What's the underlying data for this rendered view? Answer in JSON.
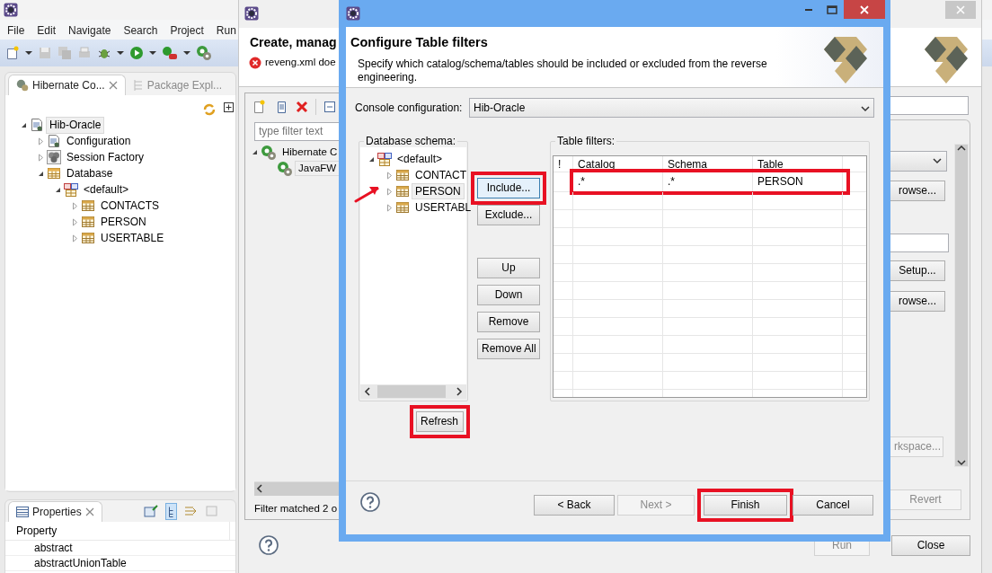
{
  "ide": {
    "menu": [
      "File",
      "Edit",
      "Navigate",
      "Search",
      "Project",
      "Run"
    ],
    "view_tabs": [
      {
        "label": "Hibernate Co...",
        "selected": true
      },
      {
        "label": "Package Expl...",
        "selected": false
      }
    ],
    "tree": [
      {
        "label": "Hib-Oracle",
        "kind": "config",
        "expanded": true,
        "selected": true,
        "children": [
          {
            "label": "Configuration",
            "kind": "config",
            "expanded": false,
            "selected": false
          },
          {
            "label": "Session Factory",
            "kind": "factory",
            "expanded": false,
            "selected": false
          },
          {
            "label": "Database",
            "kind": "database",
            "expanded": true,
            "selected": false,
            "children": [
              {
                "label": "<default>",
                "kind": "schema",
                "expanded": true,
                "selected": false,
                "children": [
                  {
                    "label": "CONTACTS",
                    "kind": "table",
                    "expanded": false,
                    "selected": false
                  },
                  {
                    "label": "PERSON",
                    "kind": "table",
                    "expanded": false,
                    "selected": false
                  },
                  {
                    "label": "USERTABLE",
                    "kind": "table",
                    "expanded": false,
                    "selected": false
                  }
                ]
              }
            ]
          }
        ]
      }
    ],
    "properties": {
      "tab": "Properties",
      "header": "Property",
      "rows": [
        "abstract",
        "abstractUnionTable"
      ]
    }
  },
  "background_dialog": {
    "heading": "Create, manag",
    "message": "reveng.xml doe",
    "filter_placeholder": "type filter text",
    "tree": [
      {
        "label": "Hibernate C",
        "kind": "hibernate",
        "expanded": true,
        "selected": false,
        "children": [
          {
            "label": "JavaFW",
            "kind": "hibernate",
            "selected": true
          }
        ]
      }
    ],
    "status": "Filter matched 2 o",
    "side_items": [
      {
        "kind": "field"
      },
      {
        "kind": "combo"
      },
      {
        "kind": "button",
        "label": "rowse...",
        "disabled": false
      },
      {
        "kind": "field"
      },
      {
        "kind": "button",
        "label": "Setup...",
        "disabled": false
      },
      {
        "kind": "button",
        "label": "rowse...",
        "disabled": false
      },
      {
        "kind": "button",
        "label": "rkspace...",
        "disabled": true
      }
    ],
    "revert": {
      "label": "Revert",
      "disabled": true
    },
    "footer_buttons": [
      {
        "label": "Run",
        "disabled": true
      },
      {
        "label": "Close",
        "disabled": false
      }
    ]
  },
  "dialog": {
    "heading": "Configure Table filters",
    "description": "Specify which catalog/schema/tables should be included or excluded from the reverse engineering.",
    "console_label": "Console configuration:",
    "console_value": "Hib-Oracle",
    "schema_label": "Database schema:",
    "schema_tree": [
      {
        "label": "<default>",
        "kind": "schema",
        "expanded": true,
        "selected": false,
        "highlighted": false,
        "children": [
          {
            "label": "CONTACT",
            "kind": "table",
            "expanded": false,
            "selected": false,
            "highlighted": false
          },
          {
            "label": "PERSON",
            "kind": "table",
            "expanded": false,
            "selected": true,
            "highlighted": true
          },
          {
            "label": "USERTABL",
            "kind": "table",
            "expanded": false,
            "selected": false,
            "highlighted": false
          }
        ]
      }
    ],
    "action_buttons": [
      {
        "label": "Include...",
        "focused": true,
        "highlighted": true
      },
      {
        "label": "Exclude...",
        "focused": false,
        "highlighted": false
      },
      {
        "label": "Up",
        "focused": false,
        "highlighted": false
      },
      {
        "label": "Down",
        "focused": false,
        "highlighted": false
      },
      {
        "label": "Remove",
        "focused": false,
        "highlighted": false
      },
      {
        "label": "Remove All",
        "focused": false,
        "highlighted": false
      }
    ],
    "refresh_button": {
      "label": "Refresh",
      "highlighted": true
    },
    "filters_label": "Table filters:",
    "filter_columns": [
      "!",
      "Catalog",
      "Schema",
      "Table"
    ],
    "filter_rows": [
      {
        "catalog": ".*",
        "schema": ".*",
        "table": "PERSON",
        "highlighted": true
      }
    ],
    "footer_buttons": [
      {
        "label": "< Back",
        "disabled": false,
        "highlighted": false
      },
      {
        "label": "Next >",
        "disabled": true,
        "highlighted": false
      },
      {
        "label": "Finish",
        "disabled": false,
        "highlighted": true
      },
      {
        "label": "Cancel",
        "disabled": false,
        "highlighted": false
      }
    ]
  }
}
